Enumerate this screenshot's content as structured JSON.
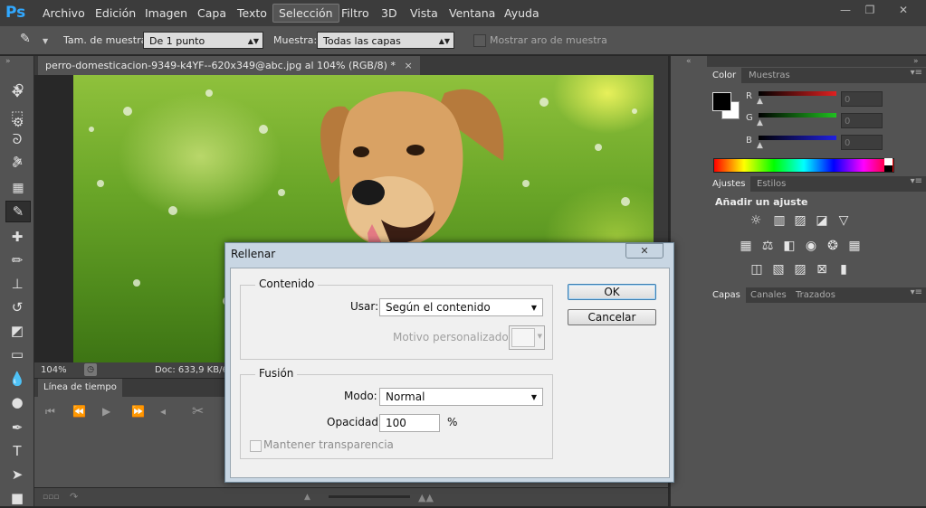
{
  "app": {
    "logo": "Ps"
  },
  "menu": [
    "Archivo",
    "Edición",
    "Imagen",
    "Capa",
    "Texto",
    "Selección",
    "Filtro",
    "3D",
    "Vista",
    "Ventana",
    "Ayuda"
  ],
  "window_controls": {
    "minimize": "—",
    "restore": "❐",
    "close": "✕"
  },
  "options": {
    "sample_size_label": "Tam. de muestra:",
    "sample_size_value": "De 1 punto",
    "sample_label": "Muestra:",
    "sample_value": "Todas las capas",
    "show_ring_label": "Mostrar aro de muestra"
  },
  "document": {
    "tab_title": "perro-domesticacion-9349-k4YF--620x349@abc.jpg al 104% (RGB/8) *",
    "tab_close": "×",
    "zoom": "104%",
    "doc_info": "Doc: 633,9 KB/63"
  },
  "timeline": {
    "title": "Línea de tiempo"
  },
  "color_panel": {
    "tabs": [
      "Color",
      "Muestras"
    ],
    "channels": [
      {
        "label": "R",
        "value": "0",
        "color": "#e02020"
      },
      {
        "label": "G",
        "value": "0",
        "color": "#20c020"
      },
      {
        "label": "B",
        "value": "0",
        "color": "#2020e0"
      }
    ]
  },
  "adjust_panel": {
    "tabs": [
      "Ajustes",
      "Estilos"
    ],
    "heading": "Añadir un ajuste"
  },
  "layers_panel": {
    "tabs": [
      "Capas",
      "Canales",
      "Trazados"
    ]
  },
  "dialog": {
    "title": "Rellenar",
    "close": "✕",
    "contents_group": "Contenido",
    "use_label": "Usar:",
    "use_value": "Según el contenido",
    "custom_pattern_label": "Motivo personalizado:",
    "blending_group": "Fusión",
    "mode_label": "Modo:",
    "mode_value": "Normal",
    "opacity_label": "Opacidad:",
    "opacity_value": "100",
    "opacity_unit": "%",
    "preserve_label": "Mantener transparencia",
    "ok": "OK",
    "cancel": "Cancelar"
  }
}
